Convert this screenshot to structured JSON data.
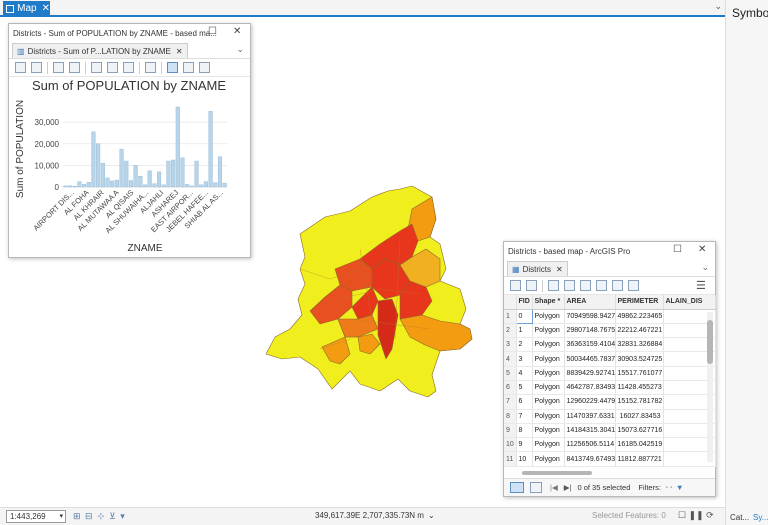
{
  "map_tab": {
    "label": "Map"
  },
  "right_panel": {
    "title": "Symbolo",
    "catalog_tab": "Cat...",
    "symbology_tab": "Sy..."
  },
  "chart_window": {
    "title": "Districts - Sum of POPULATION by ZNAME - based ma...",
    "tab_label": "Districts - Sum of P...LATION by ZNAME"
  },
  "chart_data": {
    "type": "bar",
    "title": "Sum of POPULATION by ZNAME",
    "xlabel": "ZNAME",
    "ylabel": "Sum of POPULATION",
    "ylim": [
      0,
      37000
    ],
    "yticks": [
      "0",
      "10,000",
      "20,000",
      "30,000"
    ],
    "ytick_values": [
      0,
      10000,
      20000,
      30000
    ],
    "categories": [
      "AIRPORT DIS...",
      "AL FOHA",
      "AL KHRAIR",
      "AL MUTAWAA A",
      "AL QISAIS",
      "AL SHUWAIHA...",
      "ALJAHLI",
      "ASHAREJ",
      "EAST AIRPOR...",
      "JEBEL HAFEE...",
      "SHIAB AL AS..."
    ],
    "values": [
      500,
      600,
      400,
      2500,
      1200,
      2200,
      25500,
      20000,
      11000,
      4200,
      2800,
      3200,
      17500,
      12000,
      3000,
      10000,
      5000,
      1000,
      7500,
      1500,
      7000,
      1000,
      12000,
      12500,
      37000,
      13500,
      1200,
      500,
      12000,
      1000,
      2500,
      35000,
      2000,
      14000,
      1800
    ],
    "grid": true,
    "bar_color": "#b8d4e8"
  },
  "table_window": {
    "title": "Districts - based map - ArcGIS Pro",
    "tab_label": "Districts",
    "columns": [
      "FID",
      "Shape *",
      "AREA",
      "PERIMETER",
      "ALAIN_DIS"
    ],
    "rows": [
      {
        "rn": "1",
        "fid": "0",
        "shape": "Polygon",
        "area": "70949598.9427",
        "perim": "49862.223465"
      },
      {
        "rn": "2",
        "fid": "1",
        "shape": "Polygon",
        "area": "29807148.7675",
        "perim": "22212.467221"
      },
      {
        "rn": "3",
        "fid": "2",
        "shape": "Polygon",
        "area": "36363159.4104",
        "perim": "32831.326884"
      },
      {
        "rn": "4",
        "fid": "3",
        "shape": "Polygon",
        "area": "50034465.7837",
        "perim": "30903.524725"
      },
      {
        "rn": "5",
        "fid": "4",
        "shape": "Polygon",
        "area": "8839429.92741",
        "perim": "15517.761077"
      },
      {
        "rn": "6",
        "fid": "5",
        "shape": "Polygon",
        "area": "4642787.83493",
        "perim": "11428.455273"
      },
      {
        "rn": "7",
        "fid": "6",
        "shape": "Polygon",
        "area": "12960229.4479",
        "perim": "15152.781782"
      },
      {
        "rn": "8",
        "fid": "7",
        "shape": "Polygon",
        "area": "11470397.6331",
        "perim": "16027.83453"
      },
      {
        "rn": "9",
        "fid": "8",
        "shape": "Polygon",
        "area": "14184315.3041",
        "perim": "15073.627716"
      },
      {
        "rn": "10",
        "fid": "9",
        "shape": "Polygon",
        "area": "11256506.5114",
        "perim": "16185.042519"
      },
      {
        "rn": "11",
        "fid": "10",
        "shape": "Polygon",
        "area": "8413749.67493",
        "perim": "11812.887721"
      }
    ],
    "selection_status": "0 of 35 selected",
    "filters_label": "Filters:"
  },
  "status_bar": {
    "scale": "1:443,269",
    "coordinates": "349,617.39E 2,707,335.73N m",
    "selected_features": "Selected Features: 0"
  },
  "colors": {
    "accent": "#1f7ac8",
    "choropleth_high": "#e8361c",
    "choropleth_mid": "#f39c12",
    "choropleth_low": "#f0ee1c"
  }
}
